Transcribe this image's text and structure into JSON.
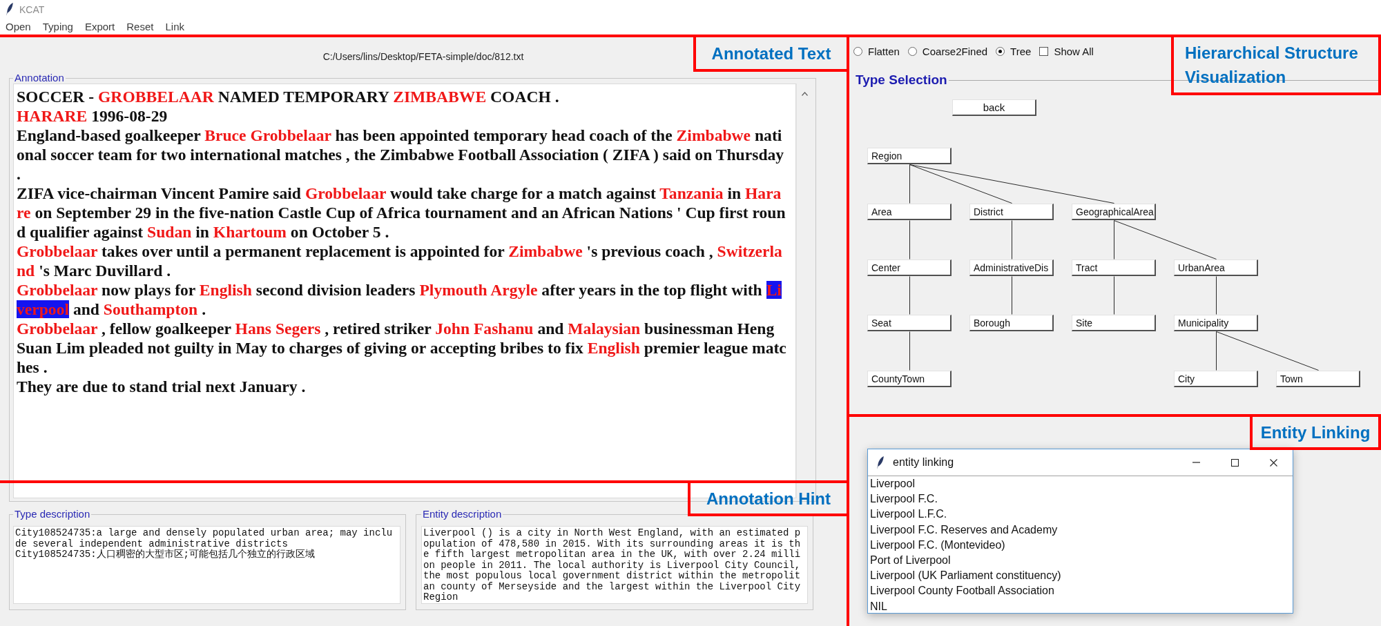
{
  "window": {
    "title": "KCAT"
  },
  "menu": [
    "Open",
    "Typing",
    "Export",
    "Reset",
    "Link"
  ],
  "annotation": {
    "file_path": "C:/Users/lins/Desktop/FETA-simple/doc/812.txt",
    "label": "Annotation",
    "paragraphs": [
      {
        "lines": [
          [
            {
              "kind": "plain",
              "text": "SOCCER - "
            },
            {
              "kind": "entity",
              "text": "GROBBELAAR",
              "selected": false
            },
            {
              "kind": "plain",
              "text": " NAMED TEMPORARY "
            },
            {
              "kind": "entity",
              "text": "ZIMBABWE",
              "selected": false
            },
            {
              "kind": "plain",
              "text": " COACH ."
            }
          ]
        ]
      },
      {
        "lines": [
          [
            {
              "kind": "entity",
              "text": "HARARE",
              "selected": false
            },
            {
              "kind": "plain",
              "text": " 1996-08-29"
            }
          ]
        ]
      },
      {
        "lines": [
          [
            {
              "kind": "plain",
              "text": "England-based goalkeeper "
            },
            {
              "kind": "entity",
              "text": "Bruce Grobbelaar",
              "selected": false
            },
            {
              "kind": "plain",
              "text": " has been appointed temporary head coach of the "
            },
            {
              "kind": "entity",
              "text": "Zimbabwe",
              "selected": false
            },
            {
              "kind": "plain",
              "text": " nati"
            }
          ],
          [
            {
              "kind": "plain",
              "text": "onal soccer team for two international matches , the Zimbabwe Football Association ( ZIFA ) said on Thursday"
            }
          ],
          [
            {
              "kind": "plain",
              "text": "."
            }
          ]
        ]
      },
      {
        "lines": [
          [
            {
              "kind": "plain",
              "text": "ZIFA vice-chairman Vincent Pamire said "
            },
            {
              "kind": "entity",
              "text": "Grobbelaar",
              "selected": false
            },
            {
              "kind": "plain",
              "text": " would take charge for a match against "
            },
            {
              "kind": "entity",
              "text": "Tanzania",
              "selected": false
            },
            {
              "kind": "plain",
              "text": " in "
            },
            {
              "kind": "entity",
              "text": "Hara",
              "selected": false
            }
          ],
          [
            {
              "kind": "entity",
              "text": "re",
              "selected": false
            },
            {
              "kind": "plain",
              "text": " on September 29 in the five-nation Castle Cup of Africa tournament and an African Nations ' Cup first roun"
            }
          ],
          [
            {
              "kind": "plain",
              "text": "d qualifier against "
            },
            {
              "kind": "entity",
              "text": "Sudan",
              "selected": false
            },
            {
              "kind": "plain",
              "text": " in "
            },
            {
              "kind": "entity",
              "text": "Khartoum",
              "selected": false
            },
            {
              "kind": "plain",
              "text": " on October 5 ."
            }
          ]
        ]
      },
      {
        "lines": [
          [
            {
              "kind": "entity",
              "text": "Grobbelaar",
              "selected": false
            },
            {
              "kind": "plain",
              "text": " takes over until a permanent replacement is appointed for "
            },
            {
              "kind": "entity",
              "text": "Zimbabwe",
              "selected": false
            },
            {
              "kind": "plain",
              "text": " 's previous coach , "
            },
            {
              "kind": "entity",
              "text": "Switzerla",
              "selected": false
            }
          ],
          [
            {
              "kind": "entity",
              "text": "nd",
              "selected": false
            },
            {
              "kind": "plain",
              "text": " 's Marc Duvillard ."
            }
          ]
        ]
      },
      {
        "lines": [
          [
            {
              "kind": "entity",
              "text": "Grobbelaar",
              "selected": false
            },
            {
              "kind": "plain",
              "text": " now plays for "
            },
            {
              "kind": "entity",
              "text": "English",
              "selected": false
            },
            {
              "kind": "plain",
              "text": " second division leaders "
            },
            {
              "kind": "entity",
              "text": "Plymouth Argyle",
              "selected": false
            },
            {
              "kind": "plain",
              "text": " after years in the top flight with "
            },
            {
              "kind": "entity",
              "text": "Li",
              "selected": true
            }
          ],
          [
            {
              "kind": "entity",
              "text": "verpool",
              "selected": true
            },
            {
              "kind": "plain",
              "text": " and "
            },
            {
              "kind": "entity",
              "text": "Southampton",
              "selected": false
            },
            {
              "kind": "plain",
              "text": " ."
            }
          ]
        ]
      },
      {
        "lines": [
          [
            {
              "kind": "entity",
              "text": "Grobbelaar",
              "selected": false
            },
            {
              "kind": "plain",
              "text": " , fellow goalkeeper "
            },
            {
              "kind": "entity",
              "text": "Hans Segers",
              "selected": false
            },
            {
              "kind": "plain",
              "text": " , retired striker "
            },
            {
              "kind": "entity",
              "text": "John Fashanu",
              "selected": false
            },
            {
              "kind": "plain",
              "text": " and "
            },
            {
              "kind": "entity",
              "text": "Malaysian",
              "selected": false
            },
            {
              "kind": "plain",
              "text": " businessman Heng"
            }
          ],
          [
            {
              "kind": "plain",
              "text": "Suan Lim pleaded not guilty in May to charges of giving or accepting bribes to fix "
            },
            {
              "kind": "entity",
              "text": "English",
              "selected": false
            },
            {
              "kind": "plain",
              "text": " premier league matc"
            }
          ],
          [
            {
              "kind": "plain",
              "text": "hes ."
            }
          ]
        ]
      },
      {
        "lines": [
          [
            {
              "kind": "plain",
              "text": "They are due to stand trial next January ."
            }
          ]
        ]
      }
    ]
  },
  "type_description": {
    "label": "Type description",
    "paragraphs": [
      {
        "lines": [
          "City108524735:a large and densely populated urban area; may inclu",
          "de several independent administrative districts"
        ]
      },
      {
        "lines": [
          "City108524735:人口稠密的大型市区;可能包括几个独立的行政区域"
        ]
      }
    ]
  },
  "entity_description": {
    "label": "Entity description",
    "paragraphs": [
      {
        "lines": [
          "Liverpool () is a city in North West England, with an estimated p",
          "opulation of 478,580 in 2015. With its surrounding areas it is th",
          "e fifth largest metropolitan area in the UK, with over 2.24 milli",
          "on people in 2011. The local authority is Liverpool City Council,",
          "the most populous local government district within the metropolit",
          "an county of Merseyside and the largest within the Liverpool City",
          "Region"
        ]
      }
    ]
  },
  "view_modes": [
    {
      "kind": "radio",
      "label": "Flatten",
      "selected": false
    },
    {
      "kind": "radio",
      "label": "Coarse2Fined",
      "selected": false
    },
    {
      "kind": "radio",
      "label": "Tree",
      "selected": true
    },
    {
      "kind": "checkbox",
      "label": "Show All",
      "checked": false
    }
  ],
  "type_selection": {
    "label": "Type Selection",
    "back_button": "back",
    "tree": {
      "label": "Region",
      "children": [
        {
          "label": "Area",
          "children": [
            {
              "label": "Center",
              "children": [
                {
                  "label": "Seat",
                  "children": [
                    {
                      "label": "CountyTown"
                    }
                  ]
                }
              ]
            }
          ]
        },
        {
          "label": "District",
          "children": [
            {
              "label": "AdministrativeDis",
              "children": [
                {
                  "label": "Borough"
                }
              ]
            }
          ]
        },
        {
          "label": "GeographicalArea",
          "children": [
            {
              "label": "Tract",
              "children": [
                {
                  "label": "Site"
                }
              ]
            },
            {
              "label": "UrbanArea",
              "children": [
                {
                  "label": "Municipality",
                  "children": [
                    {
                      "label": "City"
                    },
                    {
                      "label": "Town"
                    }
                  ]
                }
              ]
            }
          ]
        }
      ]
    }
  },
  "entity_linking": {
    "title": "entity linking",
    "candidates": [
      "Liverpool",
      "Liverpool F.C.",
      "Liverpool L.F.C.",
      "Liverpool F.C. Reserves and Academy",
      "Liverpool F.C. (Montevideo)",
      "Port of Liverpool",
      "Liverpool (UK Parliament constituency)",
      "Liverpool County Football Association",
      "NIL"
    ]
  },
  "callouts": [
    {
      "label": "Annotated Text"
    },
    {
      "label": "Hierarchical Structure Visualization"
    },
    {
      "label": "Entity Linking"
    },
    {
      "label": "Annotation Hint"
    }
  ]
}
